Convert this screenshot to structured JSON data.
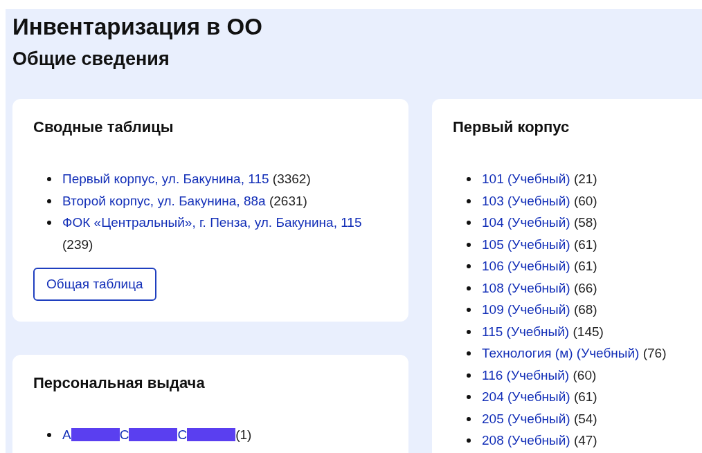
{
  "title": "Инвентаризация в ОО",
  "subtitle": "Общие сведения",
  "left_cards": [
    {
      "heading": "Сводные таблицы",
      "items": [
        {
          "link": "Первый корпус, ул. Бакунина, 115",
          "count": "(3362)"
        },
        {
          "link": "Второй корпус, ул. Бакунина, 88а",
          "count": "(2631)"
        },
        {
          "link": "ФОК «Центральный», г. Пенза, ул. Бакунина, 115",
          "count": "(239)"
        }
      ],
      "button": "Общая таблица"
    },
    {
      "heading": "Персональная выдача",
      "items": [
        {
          "link_parts": [
            "А",
            "С",
            "С"
          ],
          "count": "(1)"
        }
      ]
    }
  ],
  "right_card": {
    "heading": "Первый корпус",
    "items": [
      {
        "link": "101 (Учебный)",
        "count": "(21)"
      },
      {
        "link": "103 (Учебный)",
        "count": "(60)"
      },
      {
        "link": "104 (Учебный)",
        "count": "(58)"
      },
      {
        "link": "105 (Учебный)",
        "count": "(61)"
      },
      {
        "link": "106 (Учебный)",
        "count": "(61)"
      },
      {
        "link": "108 (Учебный)",
        "count": "(66)"
      },
      {
        "link": "109 (Учебный)",
        "count": "(68)"
      },
      {
        "link": "115 (Учебный)",
        "count": "(145)"
      },
      {
        "link": "Технология (м) (Учебный)",
        "count": "(76)"
      },
      {
        "link": "116 (Учебный)",
        "count": "(60)"
      },
      {
        "link": "204 (Учебный)",
        "count": "(61)"
      },
      {
        "link": "205 (Учебный)",
        "count": "(54)"
      },
      {
        "link": "208 (Учебный)",
        "count": "(47)"
      }
    ]
  }
}
